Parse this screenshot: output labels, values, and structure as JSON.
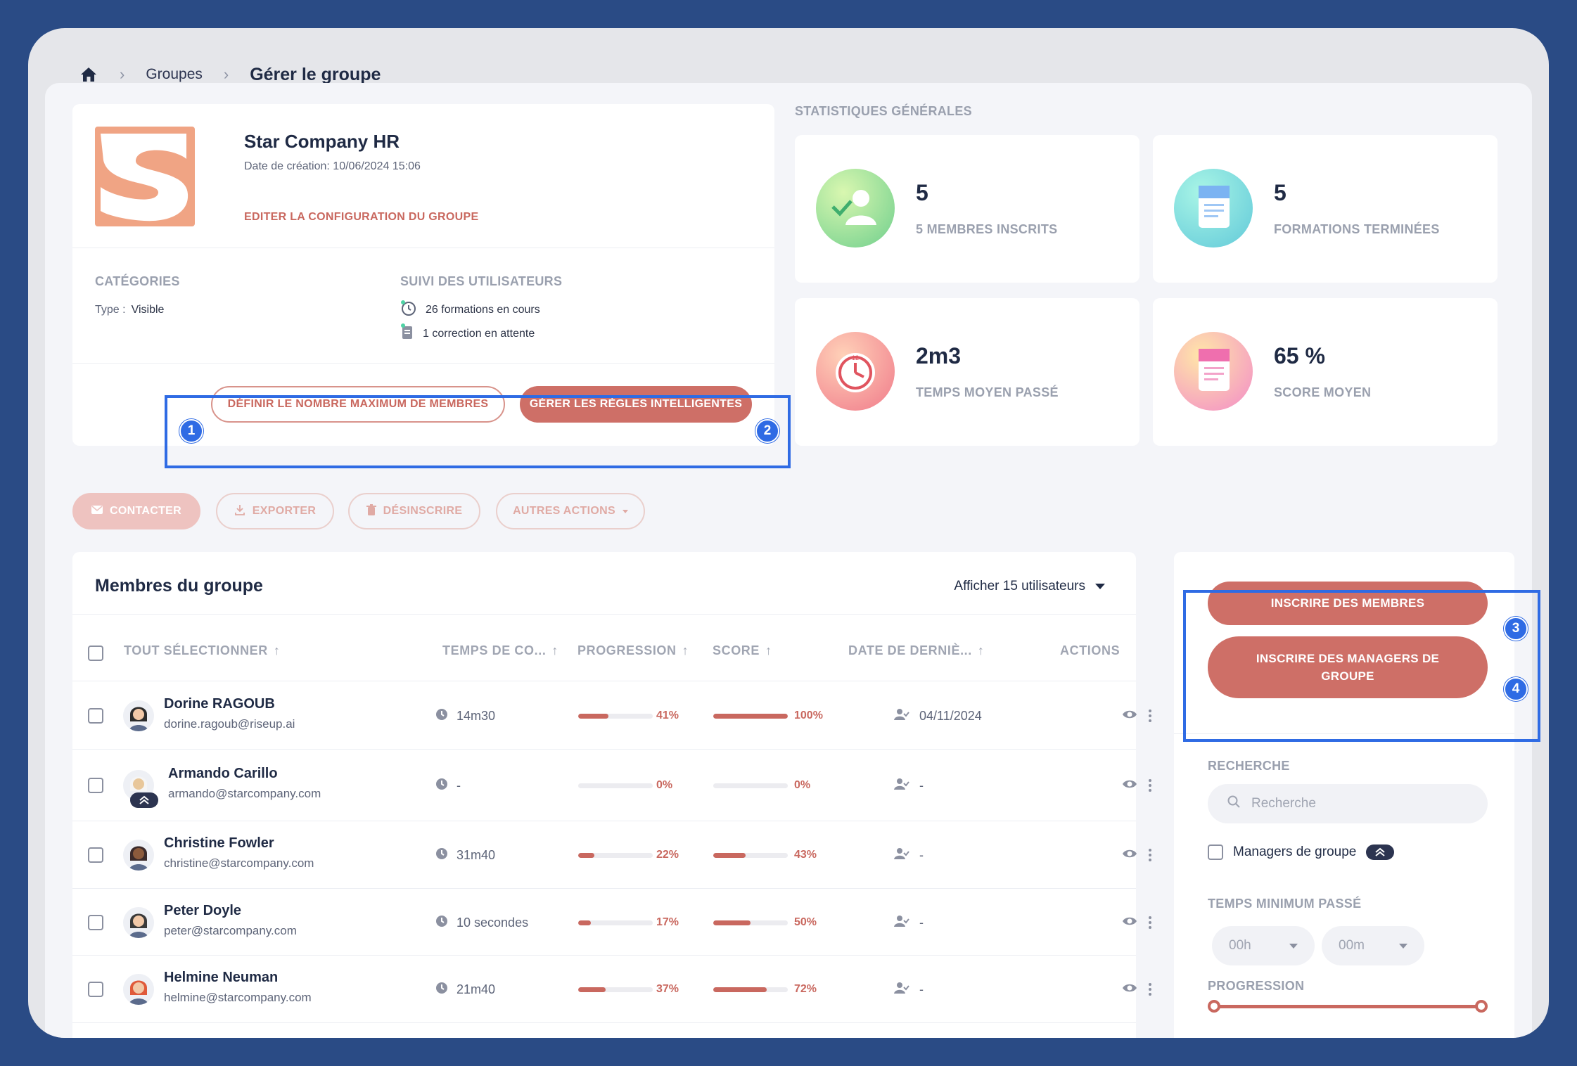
{
  "breadcrumb": {
    "home": "home",
    "groups": "Groupes",
    "current": "Gérer le groupe"
  },
  "group": {
    "name": "Star Company HR",
    "created": "Date de création: 10/06/2024 15:06",
    "edit": "EDITER LA CONFIGURATION DU GROUPE",
    "categories_title": "CATÉGORIES",
    "type_key": "Type :",
    "type_val": "Visible",
    "suivi_title": "SUIVI DES UTILISATEURS",
    "suivi_1": "26 formations en cours",
    "suivi_2": "1 correction en attente",
    "btn_max": "DÉFINIR LE NOMBRE MAXIMUM DE MEMBRES",
    "btn_rules": "GÉRER LES RÈGLES INTELLIGENTES"
  },
  "badges": [
    "1",
    "2",
    "3",
    "4"
  ],
  "stats": {
    "title": "STATISTIQUES GÉNÉRALES",
    "items": [
      {
        "value": "5",
        "label": "5 MEMBRES INSCRITS",
        "icon": "member-check-icon"
      },
      {
        "value": "5",
        "label": "FORMATIONS TERMINÉES",
        "icon": "document-icon"
      },
      {
        "value": "2m3",
        "label": "TEMPS MOYEN PASSÉ",
        "icon": "clock-icon"
      },
      {
        "value": "65 %",
        "label": "SCORE MOYEN",
        "icon": "score-icon"
      }
    ]
  },
  "actions": {
    "contact": "CONTACTER",
    "export": "EXPORTER",
    "unsubscribe": "DÉSINSCRIRE",
    "other": "AUTRES ACTIONS"
  },
  "members": {
    "title": "Membres du groupe",
    "show": "Afficher 15 utilisateurs",
    "columns": {
      "select_all": "TOUT SÉLECTIONNER",
      "time": "TEMPS DE CO...",
      "progress": "PROGRESSION",
      "score": "SCORE",
      "last": "DATE DE DERNIÈ...",
      "actions": "ACTIONS"
    },
    "rows": [
      {
        "name": "Dorine RAGOUB",
        "email": "dorine.ragoub@riseup.ai",
        "time": "14m30",
        "progress": 41,
        "progress_label": "41%",
        "score": 100,
        "score_label": "100%",
        "last": "04/11/2024"
      },
      {
        "name": "Armando Carillo",
        "email": "armando@starcompany.com",
        "time": "-",
        "progress": 0,
        "progress_label": "0%",
        "score": 0,
        "score_label": "0%",
        "last": "-"
      },
      {
        "name": "Christine Fowler",
        "email": "christine@starcompany.com",
        "time": "31m40",
        "progress": 22,
        "progress_label": "22%",
        "score": 43,
        "score_label": "43%",
        "last": "-"
      },
      {
        "name": "Peter Doyle",
        "email": "peter@starcompany.com",
        "time": "10 secondes",
        "progress": 17,
        "progress_label": "17%",
        "score": 50,
        "score_label": "50%",
        "last": "-"
      },
      {
        "name": "Helmine Neuman",
        "email": "helmine@starcompany.com",
        "time": "21m40",
        "progress": 37,
        "progress_label": "37%",
        "score": 72,
        "score_label": "72%",
        "last": "-"
      }
    ]
  },
  "side": {
    "btn_members": "INSCRIRE DES MEMBRES",
    "btn_managers_1": "INSCRIRE DES MANAGERS DE",
    "btn_managers_2": "GROUPE",
    "search_title": "RECHERCHE",
    "search_placeholder": "Recherche",
    "managers_label": "Managers de groupe",
    "min_time_title": "TEMPS MINIMUM PASSÉ",
    "hours": "00h",
    "minutes": "00m",
    "progress_title": "PROGRESSION"
  },
  "colors": {
    "accent": "#ce6f67",
    "highlight": "#2f6be4",
    "background": "#2a4b85"
  }
}
